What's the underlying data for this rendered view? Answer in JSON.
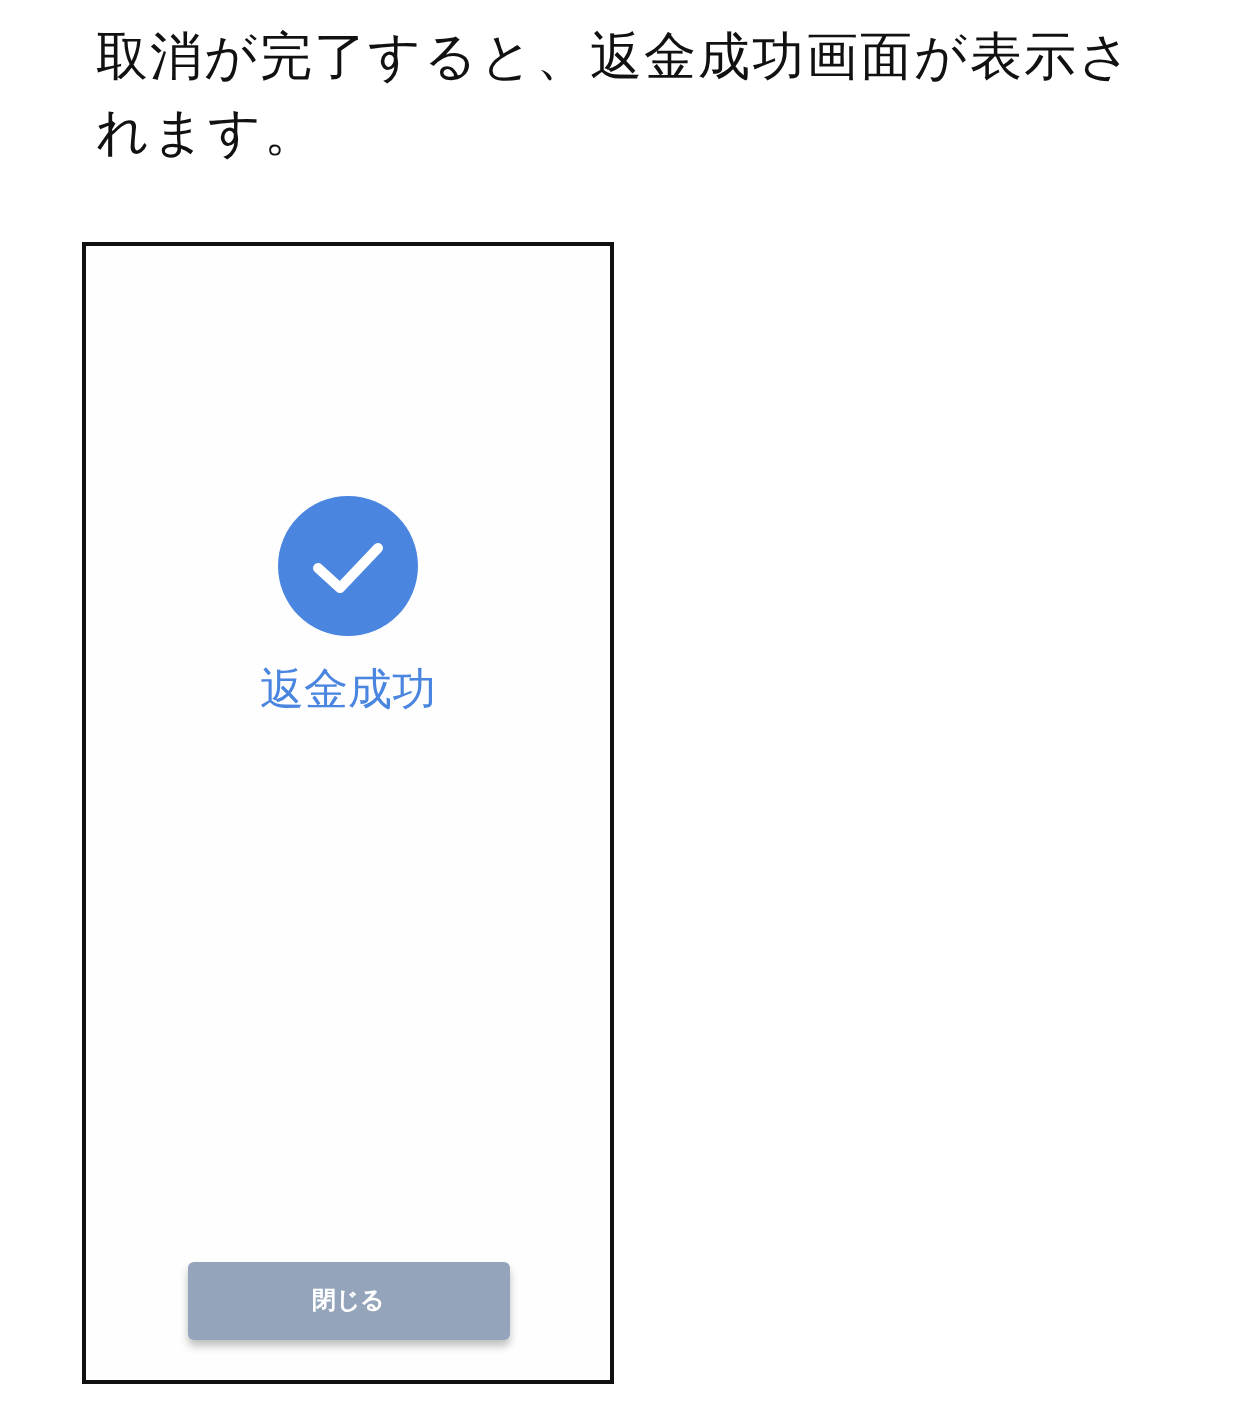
{
  "instruction": "取消が完了すると、返金成功画面が表示されます。",
  "phone_screen": {
    "status_title": "返金成功",
    "close_button": {
      "label": "閉じる",
      "disabled": true
    }
  }
}
